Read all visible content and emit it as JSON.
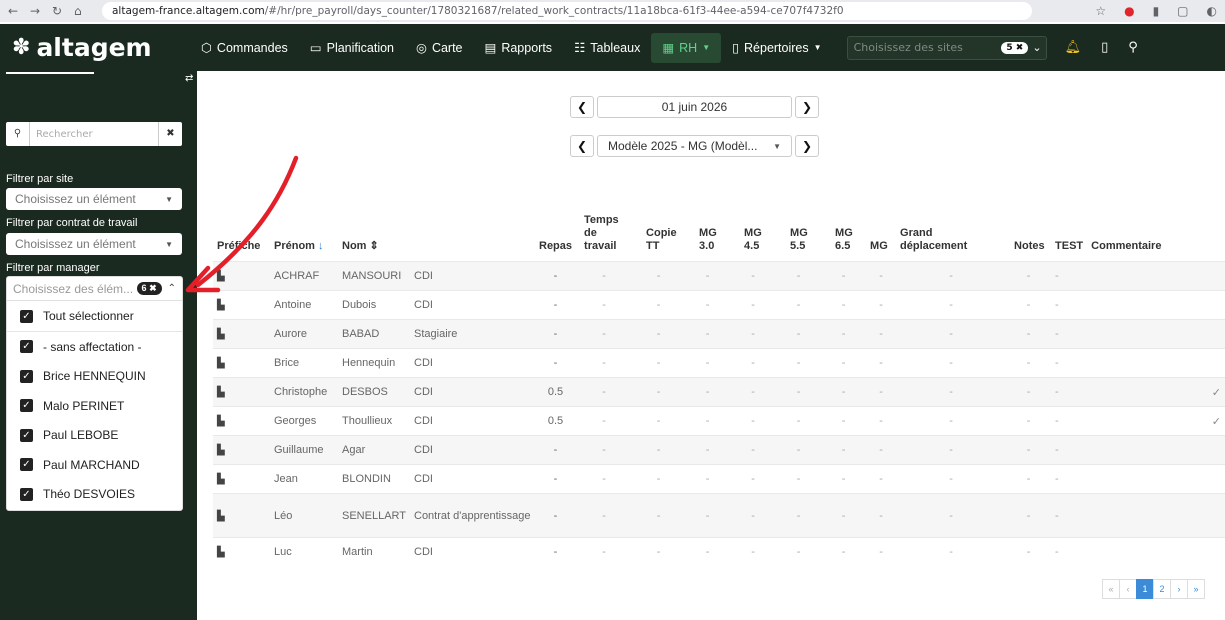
{
  "browser": {
    "url_host": "altagem-france.altagem.com",
    "url_path": "/#/hr/pre_payroll/days_counter/1780321687/related_work_contracts/11a18bca-61f3-44ee-a594-ce707f4732f0"
  },
  "brand": {
    "name": "altagem"
  },
  "topnav": {
    "items": [
      {
        "label": "Commandes",
        "icon": "box-icon"
      },
      {
        "label": "Planification",
        "icon": "calendar-icon"
      },
      {
        "label": "Carte",
        "icon": "map-pin-icon"
      },
      {
        "label": "Rapports",
        "icon": "clipboard-icon"
      },
      {
        "label": "Tableaux",
        "icon": "table-icon"
      },
      {
        "label": "RH",
        "icon": "hr-icon",
        "active": true
      },
      {
        "label": "Répertoires",
        "icon": "book-icon"
      }
    ],
    "site_placeholder": "Choisissez des sites",
    "site_badge": "5"
  },
  "sidebar": {
    "search_placeholder": "Rechercher",
    "filter_site_label": "Filtrer par site",
    "filter_site_value": "Choisissez un élément",
    "filter_contract_label": "Filtrer par contrat de travail",
    "filter_contract_value": "Choisissez un élément",
    "filter_manager_label": "Filtrer par manager",
    "manager_placeholder": "Choisissez des élém...",
    "manager_badge": "6",
    "manager_options": [
      {
        "label": "Tout sélectionner",
        "checked": true
      },
      {
        "label": "- sans affectation -",
        "checked": true
      },
      {
        "label": "Brice HENNEQUIN",
        "checked": true
      },
      {
        "label": "Malo PERINET",
        "checked": true
      },
      {
        "label": "Paul LEBOBE",
        "checked": true
      },
      {
        "label": "Paul MARCHAND",
        "checked": true
      },
      {
        "label": "Théo DESVOIES",
        "checked": true
      }
    ]
  },
  "date": {
    "value": "01 juin 2026"
  },
  "model": {
    "value": "Modèle 2025 - MG (Modèl..."
  },
  "table": {
    "headers": [
      "Préfiche",
      "Prénom",
      "Nom",
      "",
      "Repas",
      "Temps de travail",
      "Copie TT",
      "MG 3.0",
      "MG 4.5",
      "MG 5.5",
      "MG 6.5",
      "MG",
      "Grand déplacement",
      "Notes",
      "TEST",
      "Commentaire"
    ],
    "rows": [
      {
        "prenom": "ACHRAF",
        "nom": "MANSOURI",
        "contrat": "CDI",
        "repas": "-",
        "check": ""
      },
      {
        "prenom": "Antoine",
        "nom": "Dubois",
        "contrat": "CDI",
        "repas": "-",
        "check": ""
      },
      {
        "prenom": "Aurore",
        "nom": "BABAD",
        "contrat": "Stagiaire",
        "repas": "-",
        "check": ""
      },
      {
        "prenom": "Brice",
        "nom": "Hennequin",
        "contrat": "CDI",
        "repas": "-",
        "check": ""
      },
      {
        "prenom": "Christophe",
        "nom": "DESBOS",
        "contrat": "CDI",
        "repas": "0.5",
        "check": "✓"
      },
      {
        "prenom": "Georges",
        "nom": "Thoullieux",
        "contrat": "CDI",
        "repas": "0.5",
        "check": "✓"
      },
      {
        "prenom": "Guillaume",
        "nom": "Agar",
        "contrat": "CDI",
        "repas": "-",
        "check": ""
      },
      {
        "prenom": "Jean",
        "nom": "BLONDIN",
        "contrat": "CDI",
        "repas": "-",
        "check": ""
      },
      {
        "prenom": "Léo",
        "nom": "SENELLART",
        "contrat": "Contrat d'apprentissage",
        "repas": "-",
        "check": ""
      },
      {
        "prenom": "Luc",
        "nom": "Martin",
        "contrat": "CDI",
        "repas": "-",
        "check": ""
      }
    ],
    "dash": "-"
  },
  "pagination": {
    "first": "«",
    "prev": "‹",
    "pages": [
      "1",
      "2"
    ],
    "next": "›",
    "last": "»"
  }
}
